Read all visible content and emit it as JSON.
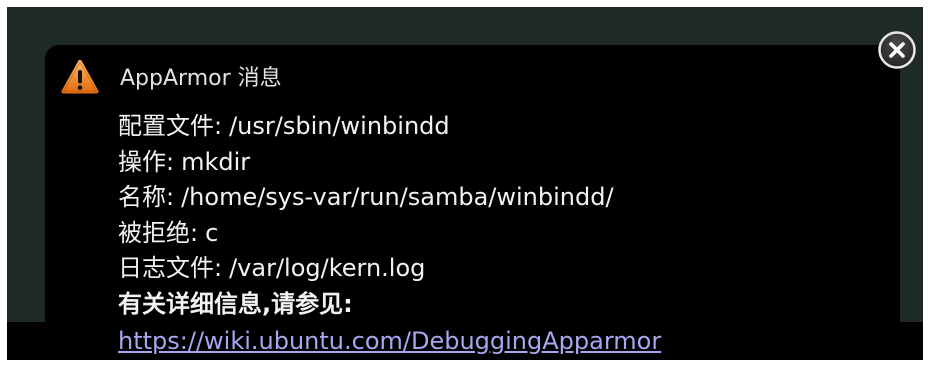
{
  "notification": {
    "title": "AppArmor 消息",
    "fields": [
      {
        "label": "配置文件:",
        "value": "/usr/sbin/winbindd"
      },
      {
        "label": "操作:",
        "value": "mkdir"
      },
      {
        "label": "名称:",
        "value": "/home/sys-var/run/samba/winbindd/"
      },
      {
        "label": "被拒绝:",
        "value": "c"
      },
      {
        "label": "日志文件:",
        "value": "/var/log/kern.log"
      }
    ],
    "more_info": "有关详细信息,请参见:",
    "link_text": "https://wiki.ubuntu.com/DebuggingApparmor",
    "icons": {
      "warning": "warning-icon",
      "close": "close-icon"
    }
  },
  "colors": {
    "desktop_background": "#1e2a23",
    "popup_background": "#000000",
    "text": "#f2f2f2",
    "link": "#a9a6f0",
    "warning": "#f08a2a"
  }
}
